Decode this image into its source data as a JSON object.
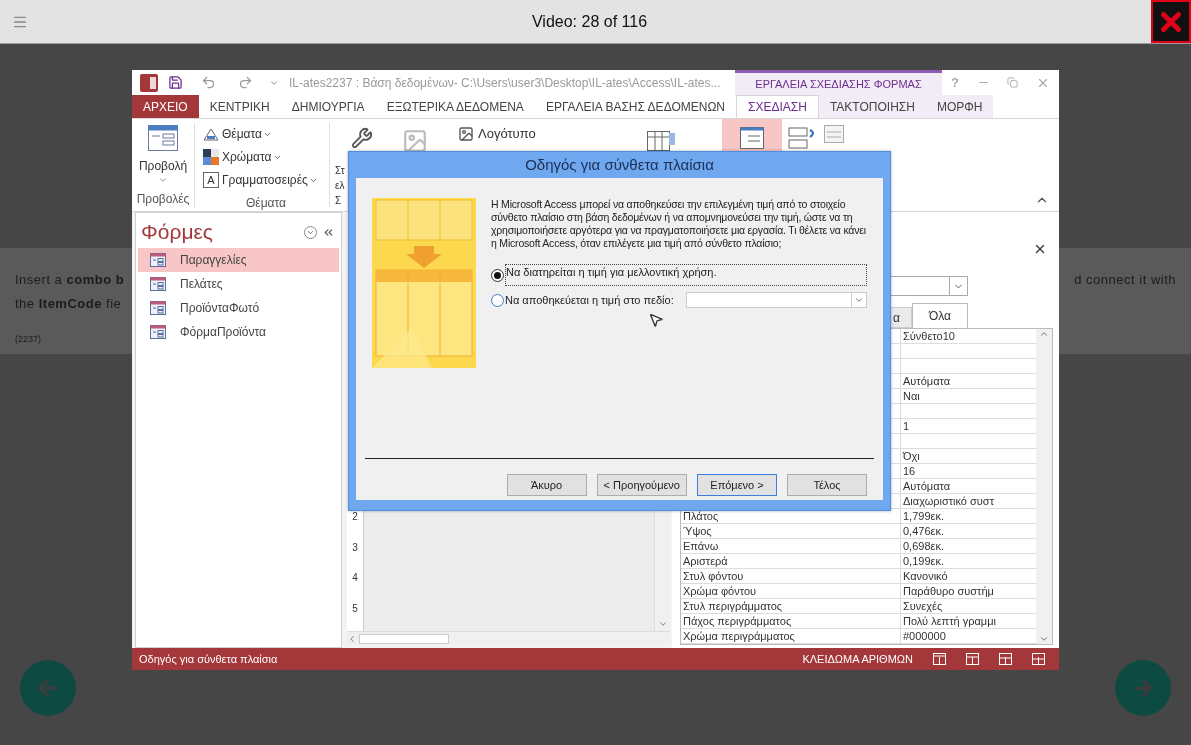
{
  "player": {
    "title": "Video: 28 of 116"
  },
  "instructions": {
    "line_1_left": "Insert a **combo b**",
    "line_1_right": "d connect it with",
    "line_2_left": "the **ItemCode** fie",
    "code": "(2237)"
  },
  "access_window": {
    "title": "IL-ates2237 : Βάση δεδομένων- C:\\Users\\user3\\Desktop\\IL-ates\\Access\\IL-ates...",
    "context_group": "ΕΡΓΑΛΕΙΑ ΣΧΕΔΙΑΣΗΣ ΦΟΡΜΑΣ",
    "help_button": "?",
    "tabs": [
      {
        "label": "ΑΡΧΕΙΟ",
        "kind": "file",
        "selected": false
      },
      {
        "label": "ΚΕΝΤΡΙΚΗ",
        "kind": "main",
        "selected": false
      },
      {
        "label": "ΔΗΜΙΟΥΡΓΙΑ",
        "kind": "main",
        "selected": false
      },
      {
        "label": "ΕΞΩΤΕΡΙΚΑ ΔΕΔΟΜΕΝΑ",
        "kind": "main",
        "selected": false
      },
      {
        "label": "ΕΡΓΑΛΕΙΑ ΒΑΣΗΣ ΔΕΔΟΜΕΝΩΝ",
        "kind": "main",
        "selected": false
      },
      {
        "label": "ΣΧΕΔΙΑΣΗ",
        "kind": "context",
        "selected": true
      },
      {
        "label": "ΤΑΚΤΟΠΟΙΗΣΗ",
        "kind": "context",
        "selected": false
      },
      {
        "label": "ΜΟΡΦΗ",
        "kind": "context",
        "selected": false
      }
    ],
    "ribbon": {
      "views_button": "Προβολή",
      "views_group": "Προβολές",
      "theme_buttons": [
        "Θέματα",
        "Χρώματα",
        "Γραμματοσειρές"
      ],
      "themes_group": "Θέματα",
      "fonts_icon": "A",
      "tools_labels": [
        "Στ",
        "ελ"
      ],
      "tools_group": "Σ",
      "logo_button": "Λογότυπο"
    },
    "nav_pane": {
      "title": "Φόρμες",
      "items": [
        {
          "label": "Παραγγελίες",
          "selected": true
        },
        {
          "label": "Πελάτες",
          "selected": false
        },
        {
          "label": "ΠροϊόνταΦωτό",
          "selected": false
        },
        {
          "label": "ΦόρμαΠροϊόντα",
          "selected": false
        }
      ]
    },
    "ruler_marks": [
      "2",
      "3",
      "4",
      "5"
    ],
    "property_sheet": {
      "tabs": [
        {
          "label": "α",
          "selected": false
        },
        {
          "label": "Όλα",
          "selected": true
        }
      ],
      "rows": [
        {
          "value": "Σύνθετο10"
        },
        {},
        {},
        {
          "value": "Αυτόματα"
        },
        {
          "value": "Ναι"
        },
        {},
        {
          "value": "1"
        },
        {},
        {
          "value": "Όχι"
        },
        {
          "value": "16"
        },
        {
          "value": "Αυτόματα"
        },
        {
          "value": "Διαχωριστικό συστ"
        },
        {
          "name": "Πλάτος",
          "value": "1,799εκ."
        },
        {
          "name": "Ύψος",
          "value": "0,476εκ."
        },
        {
          "name": "Επάνω",
          "value": "0,698εκ."
        },
        {
          "name": "Αριστερά",
          "value": "0,199εκ."
        },
        {
          "name": "Στυλ φόντου",
          "value": "Κανονικό"
        },
        {
          "name": "Χρώμα φόντου",
          "value": "Παράθυρο συστήμ"
        },
        {
          "name": "Στυλ περιγράμματος",
          "value": "Συνεχές"
        },
        {
          "name": "Πάχος περιγράμματος",
          "value": "Πολύ λεπτή γραμμι"
        },
        {
          "name": "Χρώμα περιγράμματος",
          "value": "#000000"
        }
      ]
    },
    "status_bar": {
      "left": "Οδηγός για σύνθετα πλαίσια",
      "right": "ΚΛΕΙΔΩΜΑ ΑΡΙΘΜΩΝ"
    }
  },
  "wizard": {
    "title": "Οδηγός για σύνθετα πλαίσια",
    "description": "Η Microsoft Access μπορεί να αποθηκεύσει την επιλεγμένη τιμή από το στοιχείο σύνθετο πλαίσιο στη βάση δεδομένων ή να απομνημονεύσει την τιμή, ώστε να τη χρησιμοποιήσετε αργότερα για να πραγματοποιήσετε μια εργασία. Τι θέλετε να κάνει η Microsoft Access, όταν επιλέγετε μια τιμή από σύνθετο πλαίσιο;",
    "options": [
      {
        "label": "Να διατηρείται η τιμή για μελλοντική χρήση.",
        "kind": "plain",
        "selected": true
      },
      {
        "label": "Να αποθηκεύεται η τιμή στο πεδίο:",
        "kind": "field",
        "selected": false
      }
    ],
    "buttons": [
      {
        "label": "Άκυρο",
        "focused": false
      },
      {
        "label": "< Προηγούμενο",
        "focused": false
      },
      {
        "label": "Επόμενο >",
        "focused": true
      },
      {
        "label": "Τέλος",
        "focused": false
      }
    ]
  }
}
